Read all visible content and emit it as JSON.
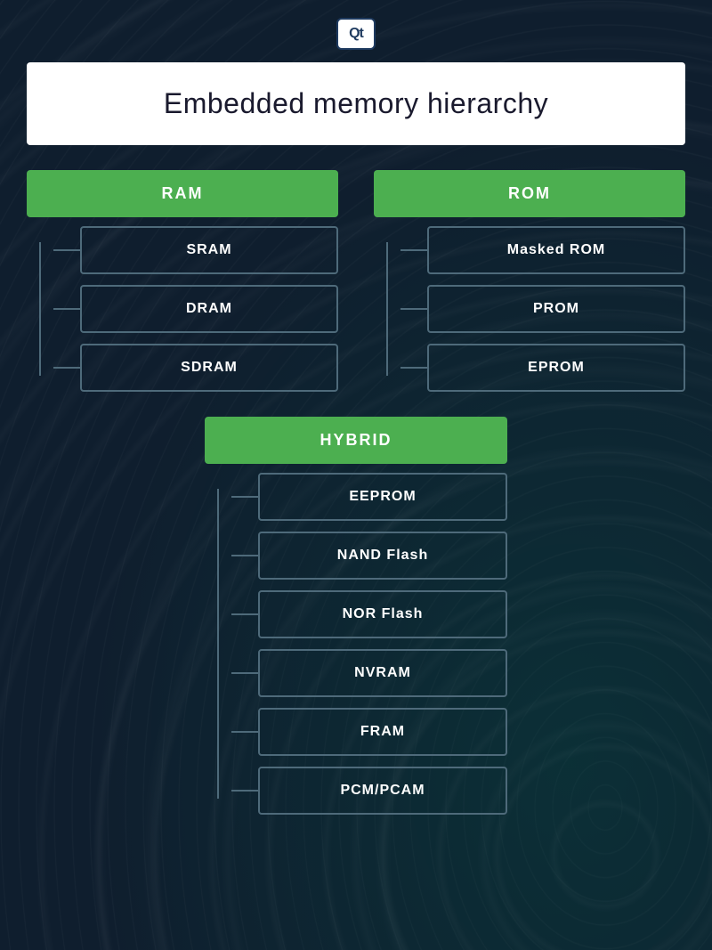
{
  "logo": {
    "text": "Qt"
  },
  "title": {
    "text": "Embedded memory hierarchy"
  },
  "ram": {
    "header": "RAM",
    "items": [
      "SRAM",
      "DRAM",
      "SDRAM"
    ]
  },
  "rom": {
    "header": "ROM",
    "items": [
      "Masked ROM",
      "PROM",
      "EPROM"
    ]
  },
  "hybrid": {
    "header": "HYBRID",
    "items": [
      "EEPROM",
      "NAND Flash",
      "NOR Flash",
      "NVRAM",
      "FRAM",
      "PCM/PCAM"
    ]
  }
}
